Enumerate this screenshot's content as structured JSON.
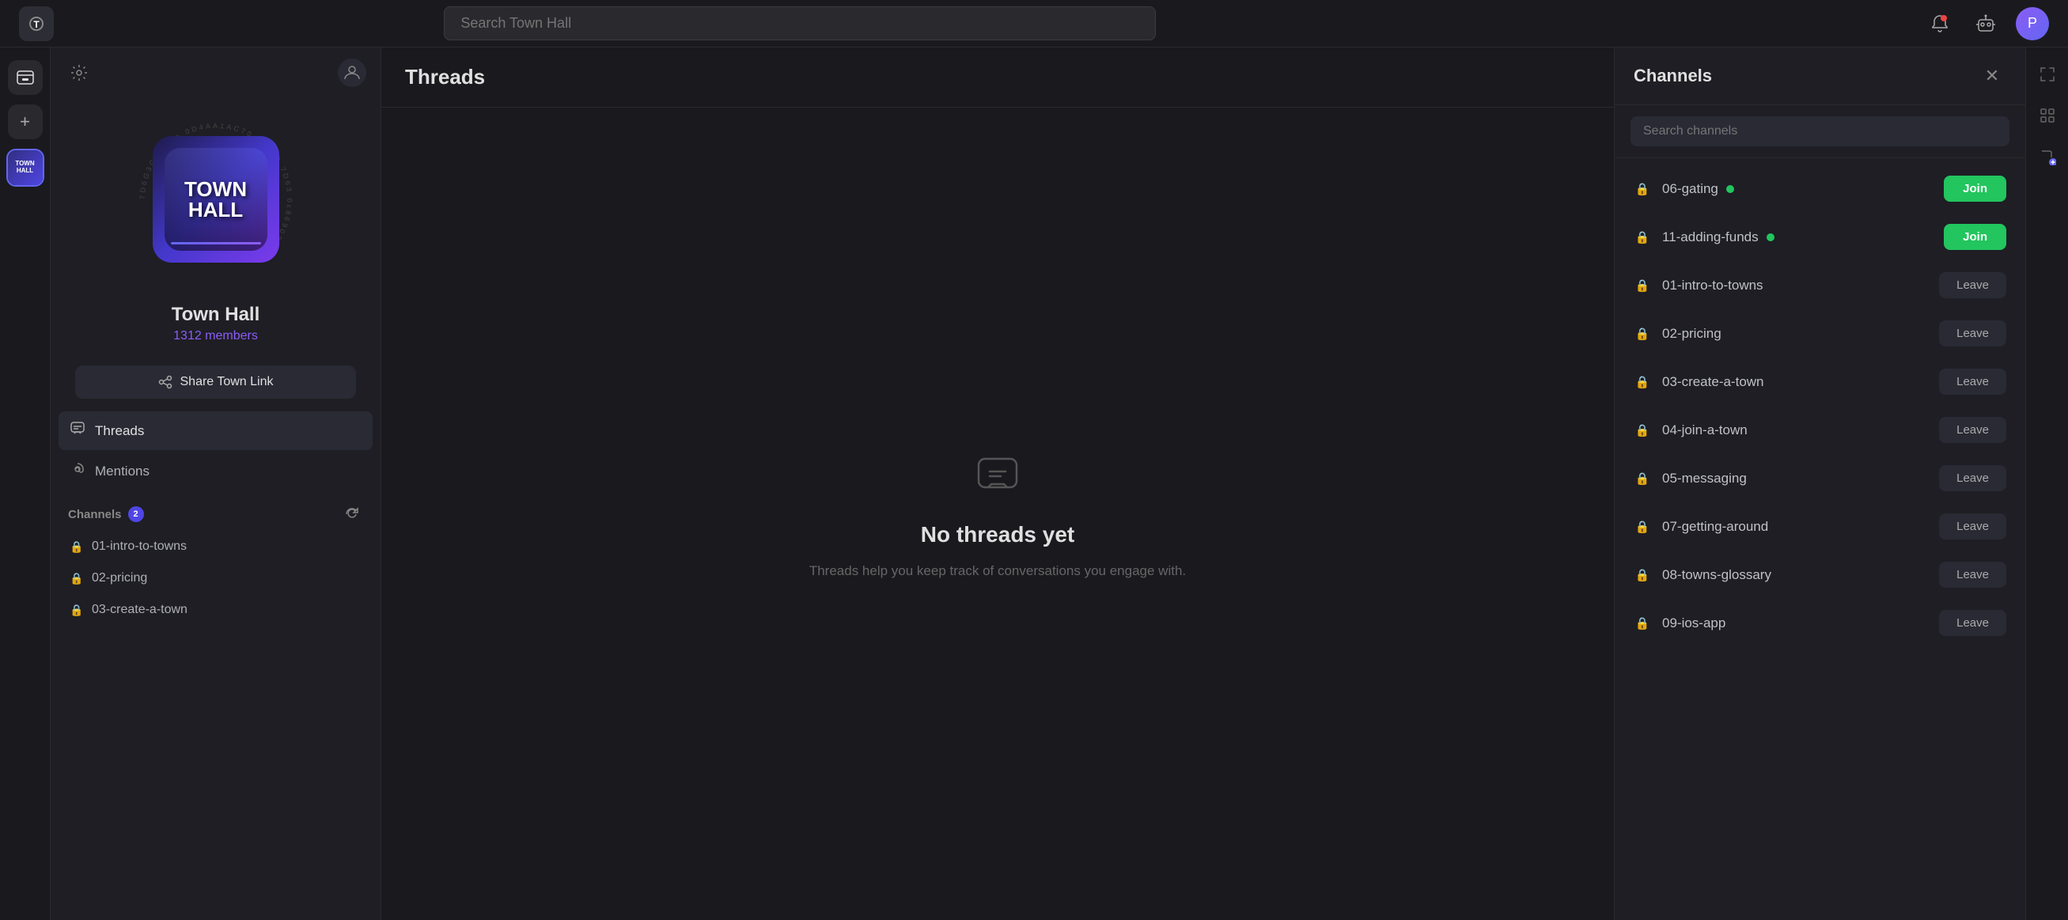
{
  "topbar": {
    "search_placeholder": "Search Town Hall",
    "logo": "T",
    "notifications_icon": "🔔",
    "settings_icon": "⚙",
    "avatar_text": "P"
  },
  "rail": {
    "inbox_icon": "📥",
    "add_icon": "+",
    "server_label": "TOWN HALL"
  },
  "sidebar": {
    "settings_icon": "⚙",
    "members_icon": "👥",
    "server_name": "Town Hall",
    "members_count": "1312 members",
    "share_link_label": "Share Town Link",
    "nav_items": [
      {
        "id": "threads",
        "label": "Threads",
        "icon": "threads"
      },
      {
        "id": "mentions",
        "label": "Mentions",
        "icon": "mentions"
      }
    ],
    "channels_label": "Channels",
    "channels_badge": "2",
    "channels": [
      {
        "name": "01-intro-to-towns"
      },
      {
        "name": "02-pricing"
      },
      {
        "name": "03-create-a-town"
      }
    ]
  },
  "main": {
    "title": "Threads",
    "empty_title": "No threads yet",
    "empty_desc": "Threads help you keep track of conversations you engage with."
  },
  "channels_panel": {
    "title": "Channels",
    "search_placeholder": "Search channels",
    "channels": [
      {
        "name": "06-gating",
        "has_dot": true,
        "action": "Join"
      },
      {
        "name": "11-adding-funds",
        "has_dot": true,
        "action": "Join"
      },
      {
        "name": "01-intro-to-towns",
        "has_dot": false,
        "action": "Leave"
      },
      {
        "name": "02-pricing",
        "has_dot": false,
        "action": "Leave"
      },
      {
        "name": "03-create-a-town",
        "has_dot": false,
        "action": "Leave"
      },
      {
        "name": "04-join-a-town",
        "has_dot": false,
        "action": "Leave"
      },
      {
        "name": "05-messaging",
        "has_dot": false,
        "action": "Leave"
      },
      {
        "name": "07-getting-around",
        "has_dot": false,
        "action": "Leave"
      },
      {
        "name": "08-towns-glossary",
        "has_dot": false,
        "action": "Leave"
      },
      {
        "name": "09-ios-app",
        "has_dot": false,
        "action": "Leave"
      }
    ]
  }
}
